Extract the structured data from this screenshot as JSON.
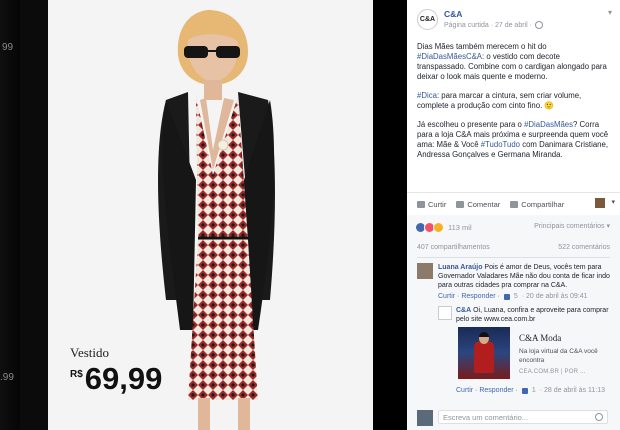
{
  "backdrop": {
    "ghost_top": "99",
    "ghost_bottom": ".99"
  },
  "price": {
    "label": "Vestido",
    "currency": "R$",
    "value": "69,99"
  },
  "post": {
    "author": "C&A",
    "logo_text": "C&A",
    "meta": "Página curtida · 27 de abril ·",
    "paragraphs": [
      {
        "parts": [
          "Dias Mães também merecem o hit do ",
          "#DiaDasMãesC&A",
          ": o vestido com decote transpassado. Combine com o cardigan alongado para deixar o look mais quente e moderno."
        ]
      },
      {
        "parts": [
          "#Dica",
          ": para marcar a cintura, sem criar volume, complete a produção com cinto fino. 🙂"
        ]
      },
      {
        "parts": [
          "Já escolheu o presente para o ",
          "#DiaDasMães",
          "? Corra para a loja C&A mais próxima e surpreenda quem você ama: Mãe & Você ",
          "#TudoTudo",
          " com Danimara Cristiane, Andressa Gonçalves e Germana Miranda."
        ]
      }
    ]
  },
  "actions": {
    "like": "Curtir",
    "comment": "Comentar",
    "share": "Compartilhar"
  },
  "reactions": {
    "count": "113 mil",
    "order": "Principais comentários ▾",
    "shares": "407 compartilhamentos",
    "comments": "522 comentários"
  },
  "comments": [
    {
      "name": "Luana Araújo",
      "text": " Pois é amor de Deus, vocês tem para Governador Valadares Mãe não dou conta de ficar indo para outras cidades pra comprar na C&A.",
      "reply": "Curtir · Responder ·",
      "likes": "5",
      "time": "· 20 de abril às 09:41"
    },
    {
      "name": "C&A",
      "text": " Oi, Luana, confira e aproveite para comprar pelo site www.cea.com.br",
      "reply": "Curtir · Responder ·",
      "likes": "1",
      "time": "· 28 de abril às 11:13"
    }
  ],
  "link_card": {
    "title": "C&A Moda",
    "desc": "Na loja virtual da C&A você encontra",
    "domain": "CEA.COM.BR | POR ..."
  },
  "write": {
    "placeholder": "Escreva um comentário..."
  },
  "colors": {
    "link": "#365899",
    "page_bg": "#000000",
    "panel_bg": "#ffffff"
  }
}
